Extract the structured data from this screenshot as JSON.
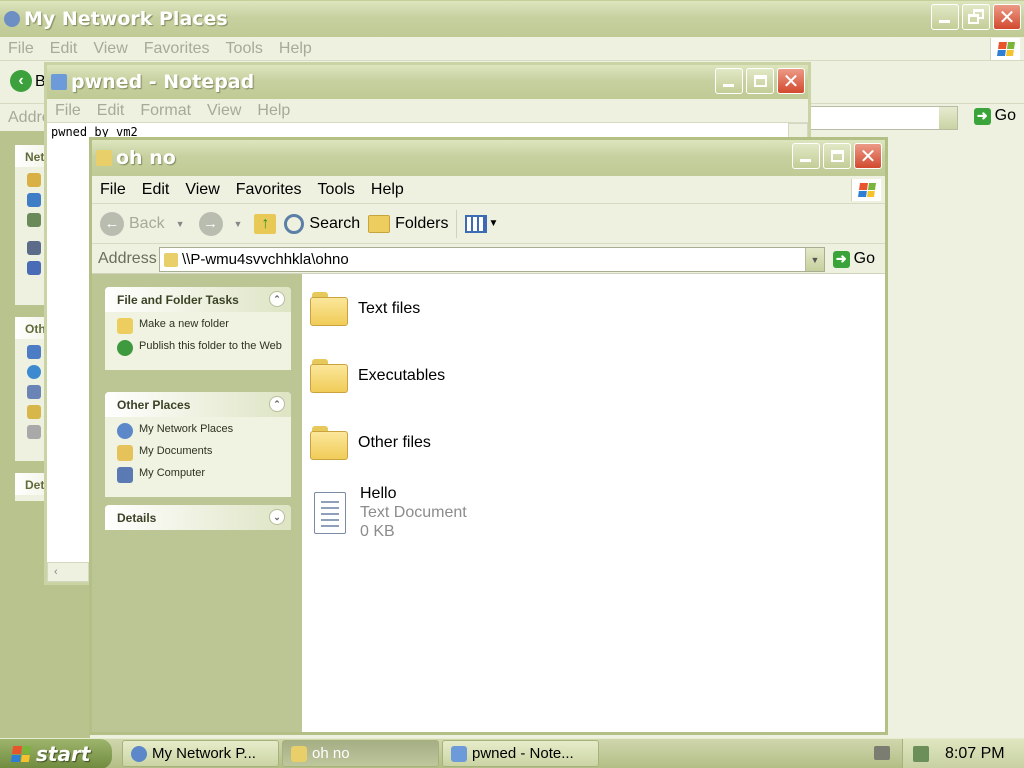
{
  "network_window": {
    "title": "My Network Places",
    "menu": [
      "File",
      "Edit",
      "View",
      "Favorites",
      "Tools",
      "Help"
    ],
    "back_label": "B",
    "address_label": "Addre",
    "go_label": "Go",
    "side_headers": [
      "Net",
      "Oth",
      "Det"
    ]
  },
  "notepad": {
    "title": "pwned - Notepad",
    "menu": [
      "File",
      "Edit",
      "Format",
      "View",
      "Help"
    ],
    "text": "pwned by vm2"
  },
  "explorer": {
    "title": "oh no",
    "menu": [
      "File",
      "Edit",
      "View",
      "Favorites",
      "Tools",
      "Help"
    ],
    "toolbar": {
      "back": "Back",
      "search": "Search",
      "folders": "Folders"
    },
    "address_label": "Address",
    "address_value": "\\\\P-wmu4svvchhkla\\ohno",
    "go_label": "Go",
    "tasks": {
      "header": "File and Folder Tasks",
      "items": [
        "Make a new folder",
        "Publish this folder to the Web"
      ]
    },
    "other_places": {
      "header": "Other Places",
      "items": [
        "My Network Places",
        "My Documents",
        "My Computer"
      ]
    },
    "details": {
      "header": "Details"
    },
    "files": [
      {
        "name": "Text files"
      },
      {
        "name": "Executables"
      },
      {
        "name": "Other files"
      },
      {
        "name": "Hello",
        "type": "Text Document",
        "size": "0 KB"
      }
    ]
  },
  "taskbar": {
    "start": "start",
    "buttons": [
      "My Network P...",
      "oh no",
      "pwned - Note..."
    ],
    "clock": "8:07 PM"
  },
  "colors": {
    "title_text": "#ffffff",
    "close_button": "#d24a2f",
    "go_arrow": "#3aa33a",
    "folder": "#f0cc58"
  }
}
